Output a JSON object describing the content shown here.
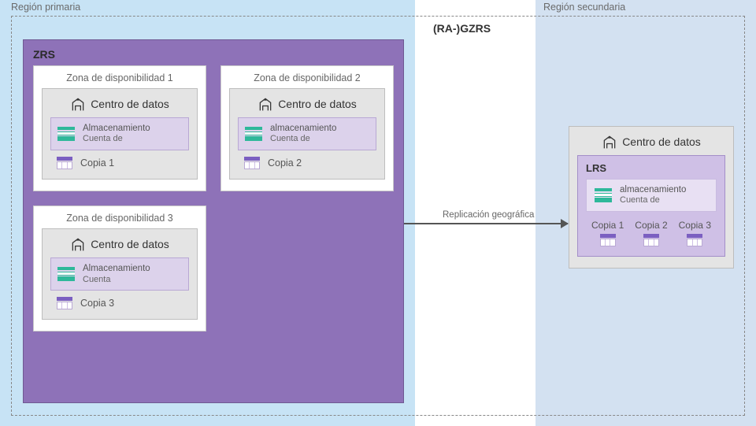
{
  "regions": {
    "primary_label": "Región primaria",
    "secondary_label": "Región secundaria"
  },
  "gzrs": {
    "label": "(RA-)GZRS"
  },
  "zrs": {
    "label": "ZRS"
  },
  "zones": [
    {
      "title": "Zona de disponibilidad 1",
      "dc_label": "Centro de datos",
      "storage": {
        "line1": "Almacenamiento",
        "line2": "Cuenta de"
      },
      "copy_label": "Copia 1"
    },
    {
      "title": "Zona de disponibilidad 2",
      "dc_label": "Centro de datos",
      "storage": {
        "line1": "almacenamiento",
        "line2": "Cuenta de"
      },
      "copy_label": "Copia 2"
    },
    {
      "title": "Zona de disponibilidad 3",
      "dc_label": "Centro de datos",
      "storage": {
        "line1": "Almacenamiento",
        "line2": "Cuenta"
      },
      "copy_label": "Copia 3"
    }
  ],
  "replication_label": "Replicación geográfica",
  "secondary_dc": {
    "dc_label": "Centro de datos",
    "lrs_label": "LRS",
    "storage": {
      "line1": "almacenamiento",
      "line2": "Cuenta de"
    },
    "copies": [
      "Copia 1",
      "Copia 2",
      "Copia 3"
    ]
  }
}
